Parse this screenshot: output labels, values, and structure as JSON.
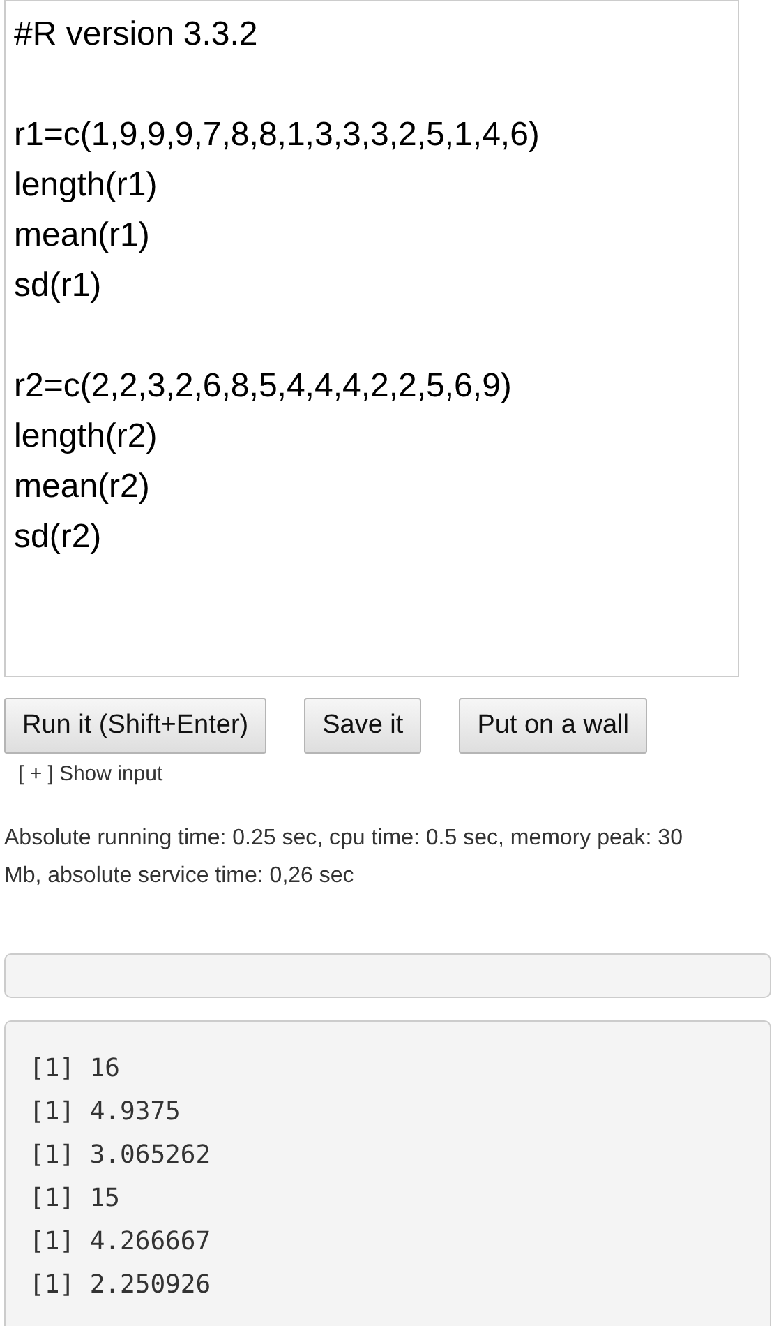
{
  "editor": {
    "code": "#R version 3.3.2\n\nr1=c(1,9,9,9,7,8,8,1,3,3,3,2,5,1,4,6)\nlength(r1)\nmean(r1)\nsd(r1)\n\nr2=c(2,2,3,2,6,8,5,4,4,4,2,2,5,6,9)\nlength(r2)\nmean(r2)\nsd(r2)"
  },
  "buttons": [
    "Run it (Shift+Enter)",
    "Save it",
    "Put on a wall"
  ],
  "show_input": {
    "toggle": "[ + ]",
    "label": "Show input"
  },
  "stats": "Absolute running time: 0.25 sec, cpu time: 0.5 sec, memory peak: 30 Mb, absolute service time: 0,26 sec",
  "output": [
    "[1] 16",
    "[1] 4.9375",
    "[1] 3.065262",
    "[1] 15",
    "[1] 4.266667",
    "[1] 2.250926"
  ]
}
